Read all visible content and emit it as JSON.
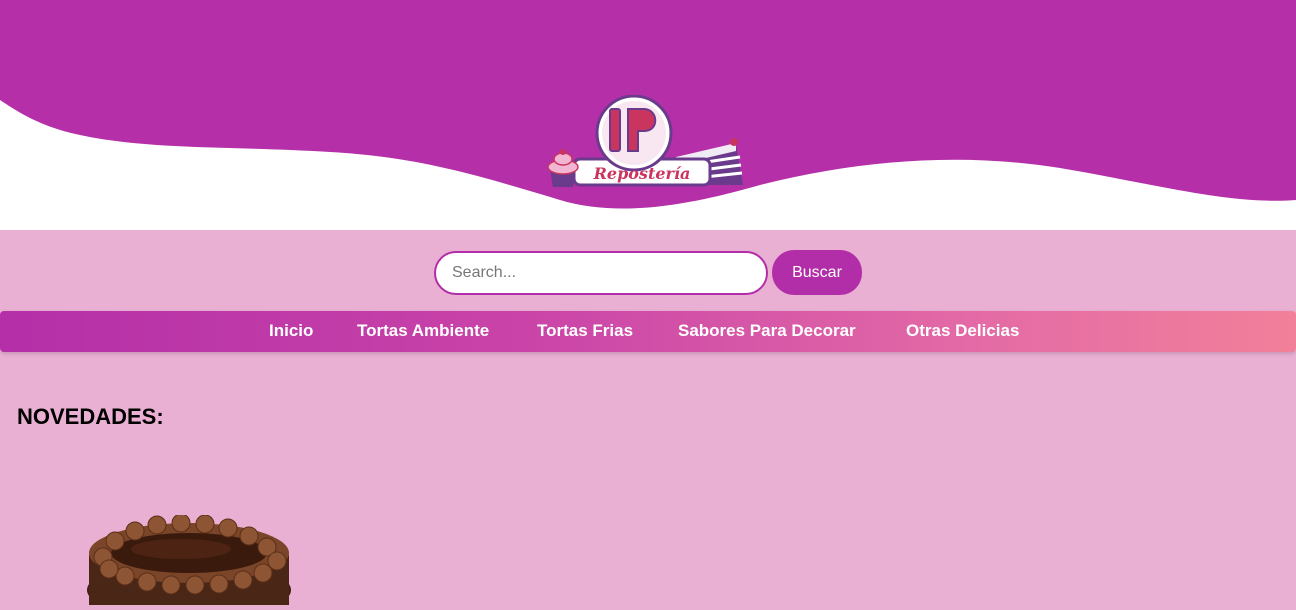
{
  "brand": {
    "logo_letters": "IP",
    "logo_word": "Repostería"
  },
  "search": {
    "placeholder": "Search...",
    "value": "",
    "button_label": "Buscar"
  },
  "nav": {
    "items": [
      {
        "label": "Inicio"
      },
      {
        "label": "Tortas Ambiente"
      },
      {
        "label": "Tortas Frias"
      },
      {
        "label": "Sabores Para Decorar"
      },
      {
        "label": "Otras Delicias"
      }
    ]
  },
  "main": {
    "section_title": "NOVEDADES:"
  },
  "colors": {
    "primary": "#b42fa8",
    "background": "#eab0d3",
    "nav_gradient_end": "#f2809a"
  }
}
